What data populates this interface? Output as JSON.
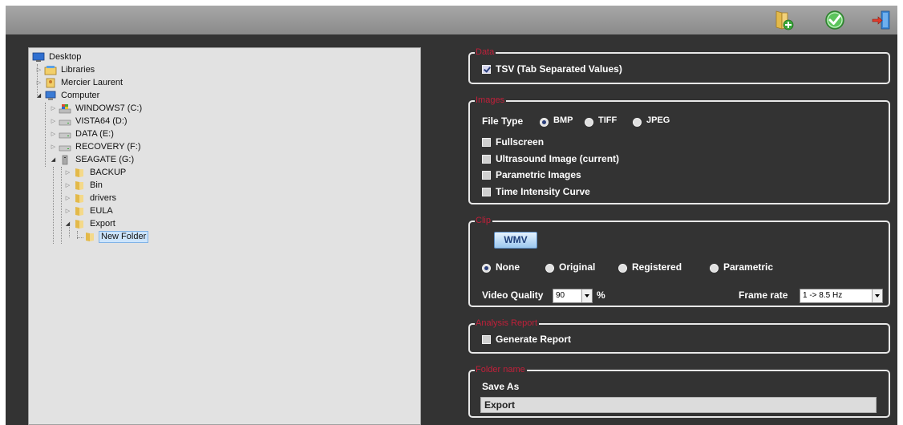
{
  "toolbar": {
    "buttons": [
      {
        "name": "add-folder",
        "icon": "folder-add-icon"
      },
      {
        "name": "confirm",
        "icon": "check-icon"
      },
      {
        "name": "exit",
        "icon": "exit-door-icon"
      }
    ]
  },
  "tree": {
    "desktop": "Desktop",
    "libraries": "Libraries",
    "user": "Mercier Laurent",
    "computer": "Computer",
    "drive_c": "WINDOWS7 (C:)",
    "drive_d": "VISTA64 (D:)",
    "drive_e": "DATA (E:)",
    "drive_f": "RECOVERY (F:)",
    "drive_g": "SEAGATE (G:)",
    "folder_backup": "BACKUP",
    "folder_bin": "Bin",
    "folder_drivers": "drivers",
    "folder_eula": "EULA",
    "folder_export": "Export",
    "folder_new": "New Folder"
  },
  "data_group": {
    "title": "Data",
    "tsv_label": "TSV (Tab Separated Values)",
    "tsv_checked": true
  },
  "images_group": {
    "title": "Images",
    "file_type_label": "File Type",
    "types": [
      "BMP",
      "TIFF",
      "JPEG"
    ],
    "selected_type": "BMP",
    "options": [
      "Fullscreen",
      "Ultrasound Image (current)",
      "Parametric Images",
      "Time Intensity Curve"
    ]
  },
  "clip_group": {
    "title": "Clip",
    "format_button": "WMV",
    "modes": [
      "None",
      "Original",
      "Registered",
      "Parametric"
    ],
    "selected_mode": "None",
    "quality_label": "Video Quality",
    "quality_value": "90",
    "quality_unit": "%",
    "frame_rate_label": "Frame rate",
    "frame_rate_value": "1 -> 8.5 Hz"
  },
  "report_group": {
    "title": "Analysis Report",
    "generate_label": "Generate Report"
  },
  "folder_group": {
    "title": "Folder name",
    "save_as_label": "Save As",
    "save_as_value": "Export"
  },
  "colors": {
    "panel_bg": "#333333",
    "toolbar_bg": "#999999",
    "group_title": "#c0203a",
    "tree_bg": "#e2e2e2"
  }
}
